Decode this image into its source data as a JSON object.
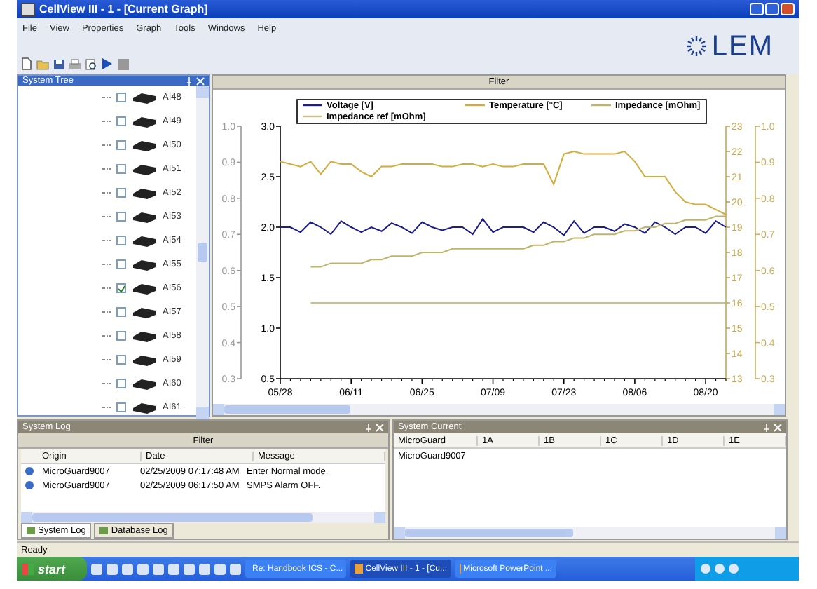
{
  "window": {
    "title": "CellView III - 1 - [Current Graph]"
  },
  "menu": [
    "File",
    "View",
    "Properties",
    "Graph",
    "Tools",
    "Windows",
    "Help"
  ],
  "logo": {
    "text": "LEM"
  },
  "system_tree": {
    "title": "System Tree",
    "items": [
      {
        "label": "AI48",
        "checked": false
      },
      {
        "label": "AI49",
        "checked": false
      },
      {
        "label": "AI50",
        "checked": false
      },
      {
        "label": "AI51",
        "checked": false
      },
      {
        "label": "AI52",
        "checked": false
      },
      {
        "label": "AI53",
        "checked": false
      },
      {
        "label": "AI54",
        "checked": false
      },
      {
        "label": "AI55",
        "checked": false
      },
      {
        "label": "AI56",
        "checked": true
      },
      {
        "label": "AI57",
        "checked": false
      },
      {
        "label": "AI58",
        "checked": false
      },
      {
        "label": "AI59",
        "checked": false
      },
      {
        "label": "AI60",
        "checked": false
      },
      {
        "label": "AI61",
        "checked": false
      }
    ]
  },
  "graph": {
    "filter": "Filter",
    "left_axis_labels": [
      "1.0",
      "0.9",
      "0.8",
      "0.7",
      "0.6",
      "0.5",
      "0.4",
      "0.3"
    ],
    "chart_data": {
      "type": "line",
      "legend": "top",
      "ylim": [
        0.5,
        3.0
      ],
      "y2lim": [
        13,
        23
      ],
      "y3lim": [
        0.3,
        1.0
      ],
      "categories": [
        "05/28",
        null,
        null,
        null,
        null,
        null,
        null,
        "06/11",
        null,
        null,
        null,
        null,
        null,
        null,
        "06/25",
        null,
        null,
        null,
        null,
        null,
        null,
        "07/09",
        null,
        null,
        null,
        null,
        null,
        null,
        "07/23",
        null,
        null,
        null,
        null,
        null,
        null,
        "08/06",
        null,
        null,
        null,
        null,
        null,
        null,
        "08/20",
        null,
        null
      ],
      "yticks": [
        {
          "value": 0.5,
          "label": "0.5"
        },
        {
          "value": 1.0,
          "label": "1.0"
        },
        {
          "value": 1.5,
          "label": "1.5"
        },
        {
          "value": 2.0,
          "label": "2.0"
        },
        {
          "value": 2.5,
          "label": "2.5"
        },
        {
          "value": 3.0,
          "label": "3.0"
        }
      ],
      "y2ticks": [
        13,
        14,
        15,
        16,
        17,
        18,
        19,
        20,
        21,
        22,
        23
      ],
      "y3ticks": [
        {
          "value": 0.3,
          "label": "0.3"
        },
        {
          "value": 0.4,
          "label": "0.4"
        },
        {
          "value": 0.5,
          "label": "0.5"
        },
        {
          "value": 0.6,
          "label": "0.6"
        },
        {
          "value": 0.7,
          "label": "0.7"
        },
        {
          "value": 0.8,
          "label": "0.8"
        },
        {
          "value": 0.9,
          "label": "0.9"
        },
        {
          "value": 1.0,
          "label": "1.0"
        }
      ],
      "series": [
        {
          "name": "Voltage [V]",
          "color": "#1c1c8a",
          "values": [
            2.0,
            2.0,
            1.95,
            2.05,
            2.0,
            1.93,
            2.06,
            2.0,
            1.95,
            2.0,
            1.96,
            2.04,
            2.0,
            1.94,
            2.05,
            2.0,
            1.97,
            2.0,
            2.0,
            1.93,
            2.08,
            1.95,
            2.0,
            2.0,
            2.0,
            1.95,
            2.05,
            2.0,
            1.92,
            2.06,
            1.94,
            2.0,
            2.0,
            1.96,
            2.03,
            2.0,
            1.94,
            2.05,
            2.0,
            1.93,
            2.0,
            2.0,
            1.94,
            2.06,
            2.0
          ]
        },
        {
          "name": "Temperature [°C]",
          "color": "#d2ac3c",
          "axis": "y2",
          "values": [
            21.6,
            21.5,
            21.4,
            21.6,
            21.1,
            21.6,
            21.5,
            21.5,
            21.2,
            21.0,
            21.4,
            21.4,
            21.5,
            21.5,
            21.5,
            21.5,
            21.4,
            21.4,
            21.5,
            21.5,
            21.4,
            21.5,
            21.4,
            21.4,
            21.5,
            21.5,
            21.5,
            20.7,
            21.9,
            22.0,
            21.9,
            21.9,
            21.9,
            21.9,
            22.0,
            21.6,
            21.0,
            21.0,
            21.0,
            20.4,
            20.0,
            19.9,
            19.9,
            19.7,
            19.5
          ]
        },
        {
          "name": "Impedance [mOhm]",
          "color": "#bfb46a",
          "axis": "y3",
          "values": [
            null,
            null,
            null,
            0.61,
            0.61,
            0.62,
            0.62,
            0.62,
            0.62,
            0.63,
            0.63,
            0.64,
            0.64,
            0.64,
            0.65,
            0.65,
            0.65,
            0.66,
            0.66,
            0.66,
            0.66,
            0.66,
            0.66,
            0.66,
            0.66,
            0.67,
            0.67,
            0.68,
            0.68,
            0.69,
            0.69,
            0.7,
            0.7,
            0.7,
            0.71,
            0.71,
            0.72,
            0.72,
            0.73,
            0.73,
            0.74,
            0.74,
            0.74,
            0.75,
            0.75
          ]
        },
        {
          "name": "Impedance ref [mOhm]",
          "color": "#c9c38a",
          "axis": "y3",
          "values": [
            null,
            null,
            null,
            0.51,
            0.51,
            0.51,
            0.51,
            0.51,
            0.51,
            0.51,
            0.51,
            0.51,
            0.51,
            0.51,
            0.51,
            0.51,
            0.51,
            0.51,
            0.51,
            0.51,
            0.51,
            0.51,
            0.51,
            0.51,
            0.51,
            0.51,
            0.51,
            0.51,
            0.51,
            0.51,
            0.51,
            0.51,
            0.51,
            0.51,
            0.51,
            0.51,
            0.51,
            0.51,
            0.51,
            0.51,
            0.51,
            0.51,
            0.51,
            0.51,
            0.51
          ]
        }
      ]
    }
  },
  "system_log": {
    "title": "System Log",
    "filter": "Filter",
    "columns": [
      "Origin",
      "Date",
      "Message"
    ],
    "rows": [
      [
        "MicroGuard9007",
        "02/25/2009 07:17:48 AM",
        "Enter Normal mode."
      ],
      [
        "MicroGuard9007",
        "02/25/2009 06:17:50 AM",
        "SMPS Alarm OFF."
      ]
    ],
    "tabs": [
      {
        "label": "System Log",
        "selected": true
      },
      {
        "label": "Database Log",
        "selected": false
      }
    ]
  },
  "system_current": {
    "title": "System Current",
    "columns": [
      "MicroGuard",
      "1A",
      "1B",
      "1C",
      "1D",
      "1E"
    ],
    "rows": [
      [
        "MicroGuard9007"
      ]
    ]
  },
  "status_bar": {
    "text": "Ready"
  },
  "taskbar": {
    "start": "start",
    "tasks": [
      {
        "label": "Re: Handbook ICS - C...",
        "selected": false
      },
      {
        "label": "CellView III - 1 - [Cu...",
        "selected": true
      },
      {
        "label": "Microsoft PowerPoint ...",
        "selected": false
      }
    ]
  }
}
